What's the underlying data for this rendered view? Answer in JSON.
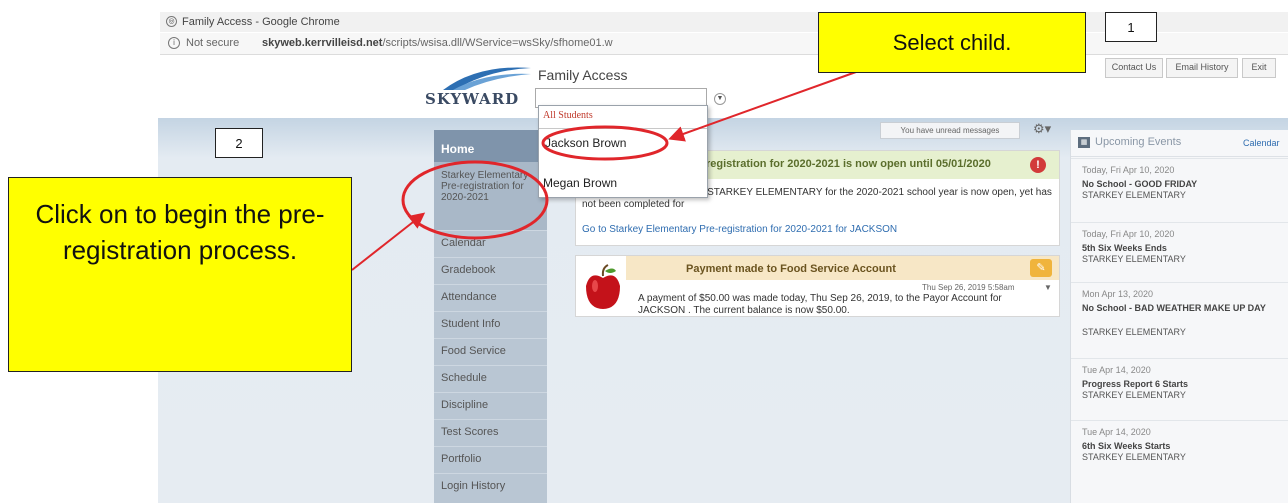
{
  "browser": {
    "window_title": "Family Access - Google Chrome",
    "security_label": "Not secure",
    "url_host": "skyweb.kerrvilleisd.net",
    "url_path": "/scripts/wsisa.dll/WService=wsSky/sfhome01.w"
  },
  "header": {
    "logo_text": "SKYWARD",
    "app_title": "Family Access",
    "buttons": [
      "Contact Us",
      "Email History",
      "Exit"
    ]
  },
  "student_dropdown": {
    "all_option": "All Students",
    "options": [
      "Jackson Brown",
      "Megan Brown"
    ]
  },
  "nav": {
    "home": "Home",
    "prereg": "Starkey Elementary Pre-registration for 2020-2021",
    "items": [
      "Calendar",
      "Gradebook",
      "Attendance",
      "Student Info",
      "Food Service",
      "Schedule",
      "Discipline",
      "Test Scores",
      "Portfolio",
      "Login History"
    ]
  },
  "messages": {
    "unread": "You have unread messages"
  },
  "card_prereg": {
    "title": "registration for 2020-2021 is now open until 05/01/2020",
    "body": "egistration for 2020-2021 at STARKEY ELEMENTARY for the 2020-2021 school year is now open, yet has not been completed for",
    "link": "Go to Starkey Elementary Pre-registration for 2020-2021 for JACKSON"
  },
  "card_food": {
    "title": "Payment made to Food Service Account",
    "date": "Thu Sep 26, 2019 5:58am",
    "body": "A payment of $50.00 was made today, Thu Sep 26, 2019, to the Payor Account for JACKSON                         . The current balance is now $50.00."
  },
  "events": {
    "title": "Upcoming Events",
    "calendar_link": "Calendar",
    "items": [
      {
        "date": "Today, Fri Apr 10, 2020",
        "title": "No School - GOOD FRIDAY",
        "school": "STARKEY ELEMENTARY"
      },
      {
        "date": "Today, Fri Apr 10, 2020",
        "title": "5th Six Weeks Ends",
        "school": "STARKEY ELEMENTARY"
      },
      {
        "date": "Mon Apr 13, 2020",
        "title": "No School - BAD WEATHER MAKE UP DAY",
        "school": "STARKEY ELEMENTARY"
      },
      {
        "date": "Tue Apr 14, 2020",
        "title": "Progress Report 6 Starts",
        "school": "STARKEY ELEMENTARY"
      },
      {
        "date": "Tue Apr 14, 2020",
        "title": "6th Six Weeks Starts",
        "school": "STARKEY ELEMENTARY"
      }
    ]
  },
  "annotations": {
    "select_child": "Select child.",
    "click_on": "Click on to begin the pre-registration process.",
    "step1": "1",
    "step2": "2"
  },
  "colors": {
    "callout": "#ffff00",
    "annotation_red": "#e0262b",
    "nav_home": "#7f94ab"
  }
}
